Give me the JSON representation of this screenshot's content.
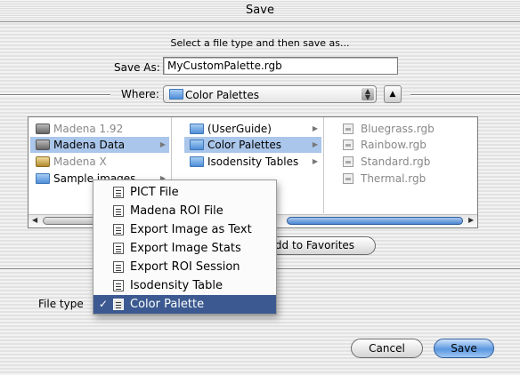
{
  "window": {
    "title": "Save"
  },
  "prompt": "Select a file type and then save as...",
  "save_as": {
    "label": "Save As:",
    "value": "MyCustomPalette.rgb"
  },
  "where": {
    "label": "Where:",
    "value": "Color Palettes"
  },
  "browser": {
    "column1": [
      {
        "label": "Madena 1.92",
        "icon": "disk-icon",
        "dimmed": true,
        "selected": false
      },
      {
        "label": "Madena Data",
        "icon": "disk-icon",
        "dimmed": false,
        "selected": true
      },
      {
        "label": "Madena X",
        "icon": "disk-icon",
        "dimmed": true,
        "selected": false
      },
      {
        "label": "Sample images",
        "icon": "folder-icon",
        "dimmed": false,
        "selected": false
      }
    ],
    "column2": [
      {
        "label": "(UserGuide)",
        "icon": "folder-icon",
        "selected": false
      },
      {
        "label": "Color Palettes",
        "icon": "folder-icon",
        "selected": true
      },
      {
        "label": "Isodensity Tables",
        "icon": "folder-icon",
        "selected": false
      }
    ],
    "column3": [
      {
        "label": "Bluegrass.rgb",
        "icon": "file-icon"
      },
      {
        "label": "Rainbow.rgb",
        "icon": "file-icon"
      },
      {
        "label": "Standard.rgb",
        "icon": "file-icon"
      },
      {
        "label": "Thermal.rgb",
        "icon": "file-icon"
      }
    ]
  },
  "add_to_favorites": "Add to Favorites",
  "file_type": {
    "label": "File type",
    "selected": "Color Palette",
    "options": [
      "PICT File",
      "Madena ROI File",
      "Export Image as Text",
      "Export Image Stats",
      "Export ROI Session",
      "Isodensity Table",
      "Color Palette"
    ]
  },
  "buttons": {
    "cancel": "Cancel",
    "save": "Save"
  },
  "colors": {
    "selection": "#3c5a91",
    "browser_selection": "#aac6ea",
    "default_button": "#5b97e0"
  }
}
